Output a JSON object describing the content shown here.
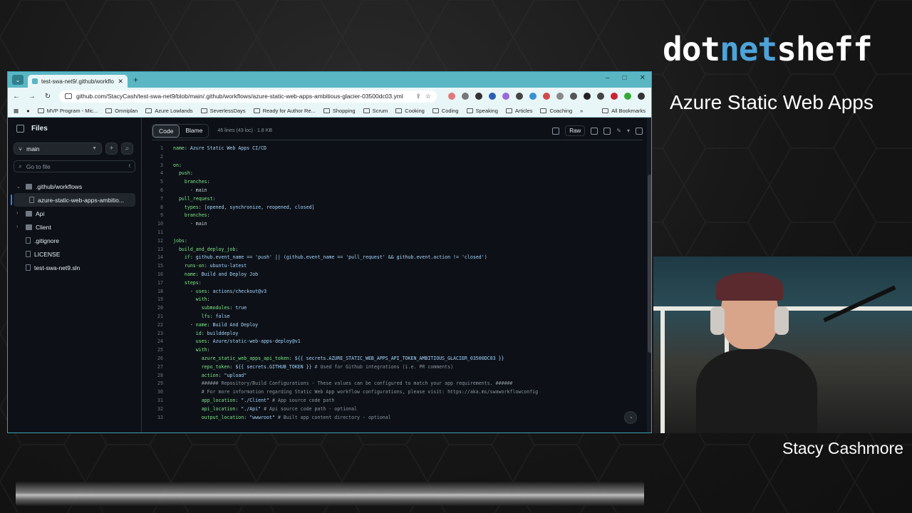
{
  "overlay": {
    "brand_part1": "dot",
    "brand_part2": "net",
    "brand_part3": "sheff",
    "subtitle": "Azure Static Web Apps",
    "presenter": "Stacy Cashmore"
  },
  "colors": {
    "brand_accent": "#4ea3d8",
    "tab_accent": "#5bb6c4",
    "gh_bg": "#0d1117",
    "yaml_key": "#7ee787",
    "active_indicator": "#2f81f7"
  },
  "browser": {
    "tab_title": "test-swa-net9/.github/workflo",
    "new_tab": "+",
    "window_controls": [
      "–",
      "□",
      "✕"
    ],
    "url": "github.com/StacyCash/test-swa-net9/blob/main/.github/workflows/azure-static-web-apps-ambitious-glacier-03500dc03.yml",
    "bookmarks": [
      "MVP Program - Mic...",
      "Omniplan",
      "Azure Lowlands",
      "SeverlessDays",
      "Ready for Author Re...",
      "Shopping",
      "Scrum",
      "Cooking",
      "Coding",
      "Speaking",
      "Articles",
      "Coaching"
    ],
    "more_bookmarks": "»",
    "all_bookmarks": "All Bookmarks"
  },
  "sidebar": {
    "title": "Files",
    "branch": "main",
    "search_placeholder": "Go to file",
    "search_shortcut": "t",
    "tree": [
      {
        "label": ".github/workflows",
        "type": "folder",
        "expanded": true
      },
      {
        "label": "azure-static-web-apps-ambitio...",
        "type": "file",
        "active": true
      },
      {
        "label": "Api",
        "type": "folder"
      },
      {
        "label": "Client",
        "type": "folder"
      },
      {
        "label": ".gitignore",
        "type": "file"
      },
      {
        "label": "LICENSE",
        "type": "file"
      },
      {
        "label": "test-swa-net9.sln",
        "type": "file"
      }
    ]
  },
  "code_view": {
    "tab_code": "Code",
    "tab_blame": "Blame",
    "meta": "46 lines (43 loc) · 1.8 KB",
    "raw_label": "Raw",
    "lines": [
      "name: Azure Static Web Apps CI/CD",
      "",
      "on:",
      "  push:",
      "    branches:",
      "      - main",
      "  pull_request:",
      "    types: [opened, synchronize, reopened, closed]",
      "    branches:",
      "      - main",
      "",
      "jobs:",
      "  build_and_deploy_job:",
      "    if: github.event_name == 'push' || (github.event_name == 'pull_request' && github.event.action != 'closed')",
      "    runs-on: ubuntu-latest",
      "    name: Build and Deploy Job",
      "    steps:",
      "      - uses: actions/checkout@v3",
      "        with:",
      "          submodules: true",
      "          lfs: false",
      "      - name: Build And Deploy",
      "        id: builddeploy",
      "        uses: Azure/static-web-apps-deploy@v1",
      "        with:",
      "          azure_static_web_apps_api_token: ${{ secrets.AZURE_STATIC_WEB_APPS_API_TOKEN_AMBITIOUS_GLACIER_03500DC03 }}",
      "          repo_token: ${{ secrets.GITHUB_TOKEN }} # Used for Github integrations (i.e. PR comments)",
      "          action: \"upload\"",
      "          ###### Repository/Build Configurations - These values can be configured to match your app requirements. ######",
      "          # For more information regarding Static Web App workflow configurations, please visit: https://aka.ms/swaworkflowconfig",
      "          app_location: \"./Client\" # App source code path",
      "          api_location: \"./Api\" # Api source code path - optional",
      "          output_location: \"wwwroot\" # Built app content directory - optional"
    ]
  }
}
